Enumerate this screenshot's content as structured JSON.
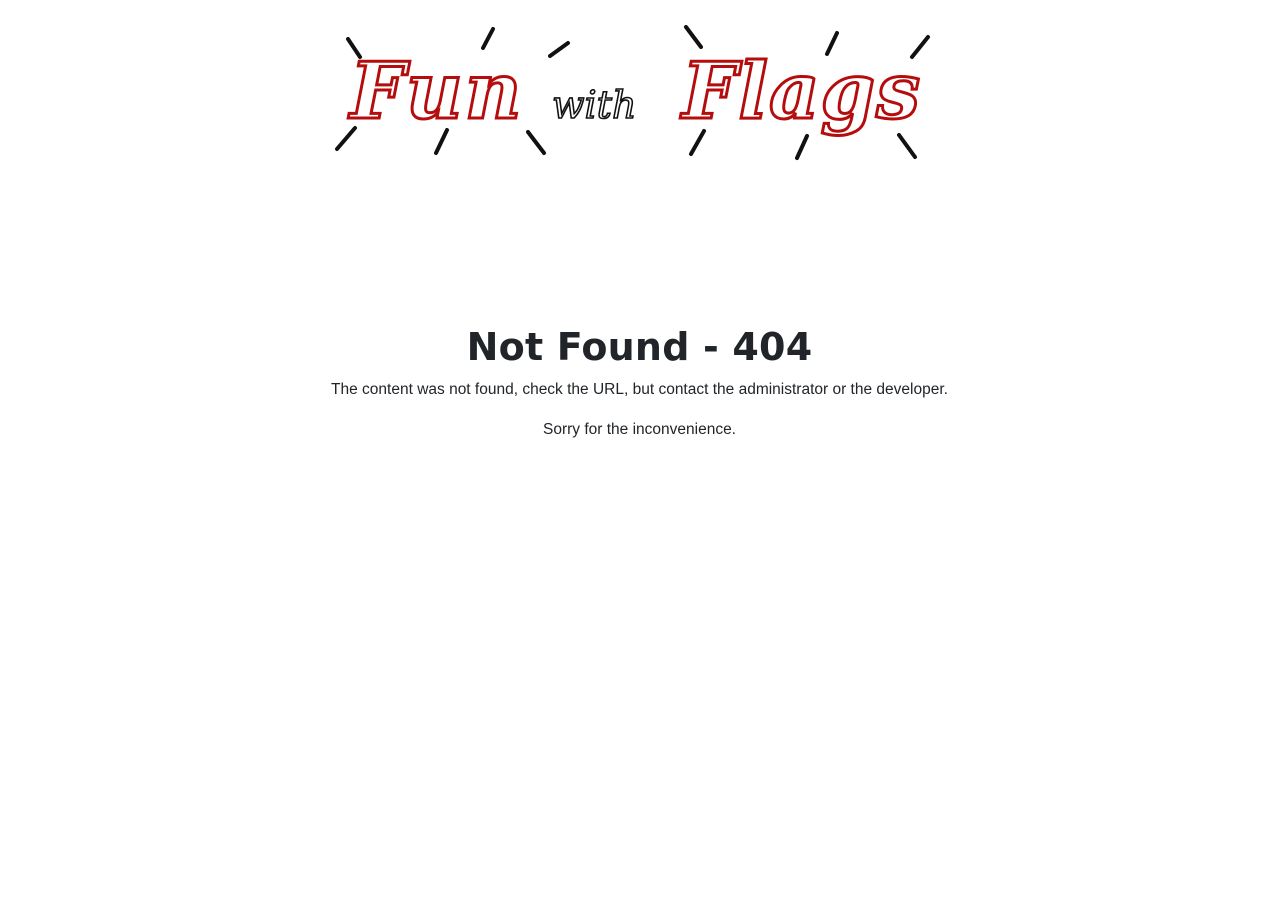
{
  "logo": {
    "text_word1": "Fun",
    "text_word2": "with",
    "text_word3": "Flags",
    "accent_color": "#b50d0d",
    "ink_color": "#111111"
  },
  "error": {
    "title": "Not Found - 404",
    "message": "The content was not found, check the URL, but contact the administrator or the developer.",
    "apology": "Sorry for the inconvenience."
  }
}
